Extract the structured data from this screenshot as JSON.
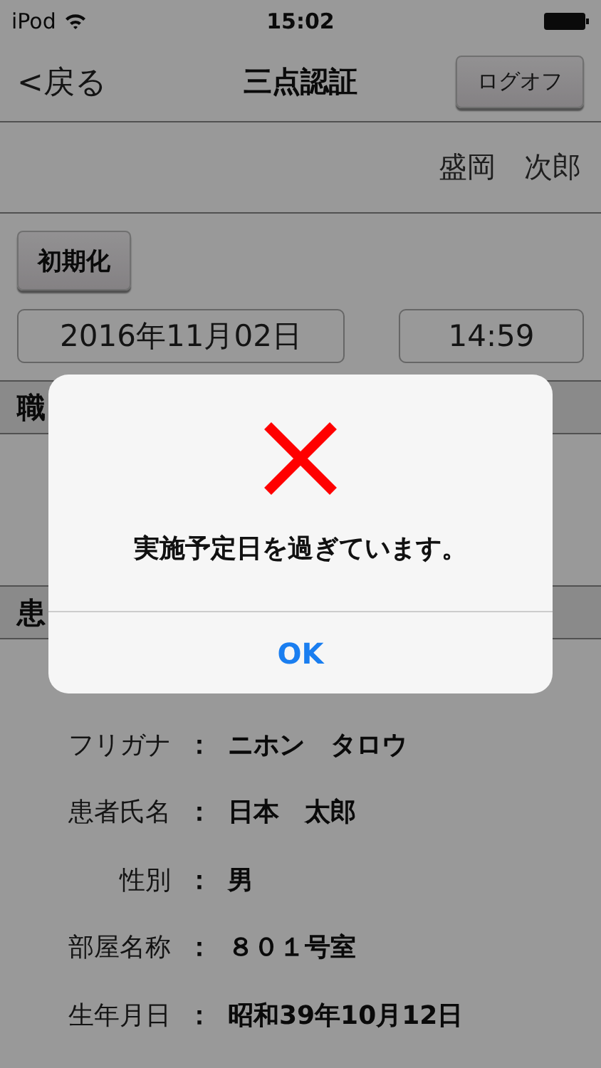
{
  "status_bar": {
    "carrier": "iPod",
    "time": "15:02"
  },
  "nav": {
    "back": "<戻る",
    "title": "三点認証",
    "logoff": "ログオフ"
  },
  "user_name": "盛岡　次郎",
  "reset_button": "初期化",
  "date": "2016年11月02日",
  "time": "14:59",
  "sections": [
    {
      "title": "職"
    },
    {
      "title": "患"
    }
  ],
  "patient_fields": [
    {
      "label": "フリガナ",
      "separator": "：",
      "value": "ニホン　タロウ"
    },
    {
      "label": "患者氏名",
      "separator": "：",
      "value": "日本　太郎"
    },
    {
      "label": "性別",
      "separator": "：",
      "value": "男"
    },
    {
      "label": "部屋名称",
      "separator": "：",
      "value": "８０１号室"
    },
    {
      "label": "生年月日",
      "separator": "：",
      "value": "昭和39年10月12日"
    }
  ],
  "alert": {
    "message": "実施予定日を過ぎています。",
    "button": "OK"
  }
}
